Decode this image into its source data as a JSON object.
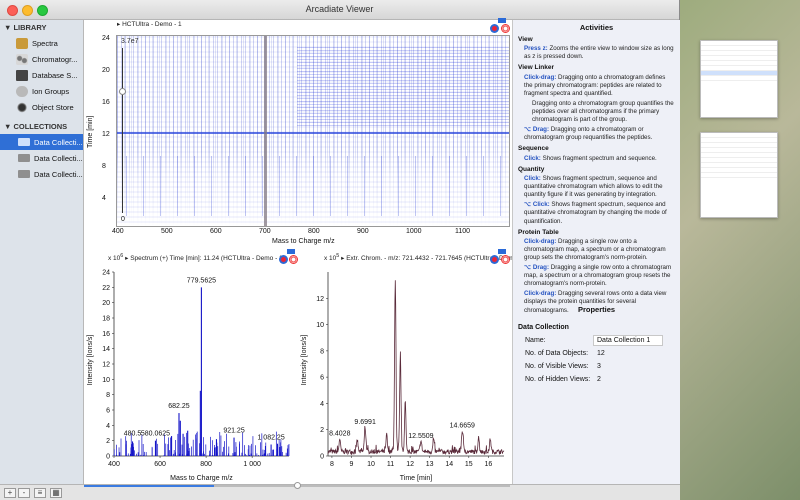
{
  "window": {
    "title": "Arcadiate Viewer"
  },
  "sidebar": {
    "library_header": "LIBRARY",
    "library_items": [
      {
        "label": "Spectra",
        "icon": "spectra-icon"
      },
      {
        "label": "Chromatogr...",
        "icon": "chromatogram-icon"
      },
      {
        "label": "Database S...",
        "icon": "database-icon"
      },
      {
        "label": "Ion Groups",
        "icon": "ion-groups-icon"
      },
      {
        "label": "Object Store",
        "icon": "object-store-icon"
      }
    ],
    "collections_header": "COLLECTIONS",
    "collection_items": [
      {
        "label": "Data Collecti...",
        "selected": true
      },
      {
        "label": "Data Collecti...",
        "selected": false
      },
      {
        "label": "Data Collecti...",
        "selected": false
      }
    ]
  },
  "heatmap": {
    "title": "HCTUltra - Demo - 1",
    "max_label": "3.7e7",
    "min_label": "0",
    "ylabel": "Time [min]",
    "xlabel": "Mass to Charge m/z",
    "yticks": [
      "24",
      "20",
      "16",
      "12",
      "8",
      "4"
    ],
    "xticks": [
      "400",
      "500",
      "600",
      "700",
      "800",
      "900",
      "1000",
      "1100"
    ]
  },
  "spectrum": {
    "title": "Spectrum (+) Time [min]: 11.24 (HCTUltra - Demo - 1)",
    "exponent": "x 10",
    "exponent_power": "6",
    "ylabel": "Intensity [Ions/s]",
    "xlabel": "Mass to Charge m/z",
    "xticks": [
      "400",
      "600",
      "800",
      "1 000"
    ],
    "yticks": [
      "0",
      "2",
      "4",
      "6",
      "8",
      "10",
      "12",
      "14",
      "16",
      "18",
      "20",
      "22",
      "24"
    ],
    "peak_labels": [
      "779.5625",
      "682.25",
      "480.5",
      "580.0625",
      "921.25",
      "1 082.25"
    ]
  },
  "chromatogram": {
    "title": "Extr. Chrom. - m/z: 721.4432 - 721.7645 (HCTUltra - Demo - 1)",
    "exponent": "x 10",
    "exponent_power": "5",
    "ylabel": "Intensity [Ions/s]",
    "xlabel": "Time [min]",
    "xticks": [
      "8",
      "9",
      "10",
      "11",
      "12",
      "13",
      "14",
      "15",
      "16"
    ],
    "yticks": [
      "0",
      "2",
      "4",
      "6",
      "8",
      "10",
      "12"
    ],
    "peak_labels": [
      "8.4028",
      "9.6991",
      "12.5509",
      "14.6659"
    ]
  },
  "activities": {
    "title": "Activities",
    "sections": [
      {
        "head": "View",
        "items": [
          {
            "key": "Press z:",
            "text": "Zooms the entire view to window size as long as z is pressed down."
          }
        ]
      },
      {
        "head": "View Linker",
        "items": [
          {
            "key": "Click-drag:",
            "text": "Dragging onto a chromatogram defines the primary chromatogram: peptides are related to fragment spectra and quantified."
          },
          {
            "key": "",
            "text": "Dragging onto a chromatogram group quantifies the peptides over all chromatograms if the primary chromatogram is part of the group."
          },
          {
            "key": "⌥ Drag:",
            "text": "Dragging onto a chromatogram or chromatogram group requantifies the peptides."
          }
        ]
      },
      {
        "head": "Sequence",
        "items": [
          {
            "key": "Click:",
            "text": "Shows fragment spectrum and sequence."
          }
        ]
      },
      {
        "head": "Quantity",
        "items": [
          {
            "key": "Click:",
            "text": "Shows fragment spectrum, sequence and quantitative chromatogram which allows to edit the quantity figure if it was generating by integration."
          },
          {
            "key": "⌥ Click:",
            "text": "Shows fragment spectrum, sequence and quantitative chromatogram by changing the mode of quantification."
          }
        ]
      },
      {
        "head": "Protein Table",
        "items": [
          {
            "key": "Click-drag:",
            "text": "Dragging a single row onto a chromatogram map, a spectrum or a chromatogram group sets the chromatogram's norm-protein."
          },
          {
            "key": "⌥ Drag:",
            "text": "Dragging a single row onto a chromatogram map, a spectrum or a chromatogram group resets the chromatogram's norm-protein."
          },
          {
            "key": "Click-drag:",
            "text": "Dragging several rows onto a data view displays the protein quantities for several chromatograms."
          }
        ]
      }
    ]
  },
  "properties": {
    "title": "Properties",
    "subtitle": "Data Collection",
    "rows": [
      {
        "key": "Name:",
        "value": "Data Collection 1",
        "boxed": true
      },
      {
        "key": "No. of Data Objects:",
        "value": "12"
      },
      {
        "key": "No. of Visible Views:",
        "value": "3"
      },
      {
        "key": "No. of Hidden Views:",
        "value": "2"
      }
    ]
  },
  "colors": {
    "accent": "#2f6fd6",
    "plot_blue": "#1414c8",
    "chrom_line": "#5a2a3a"
  }
}
